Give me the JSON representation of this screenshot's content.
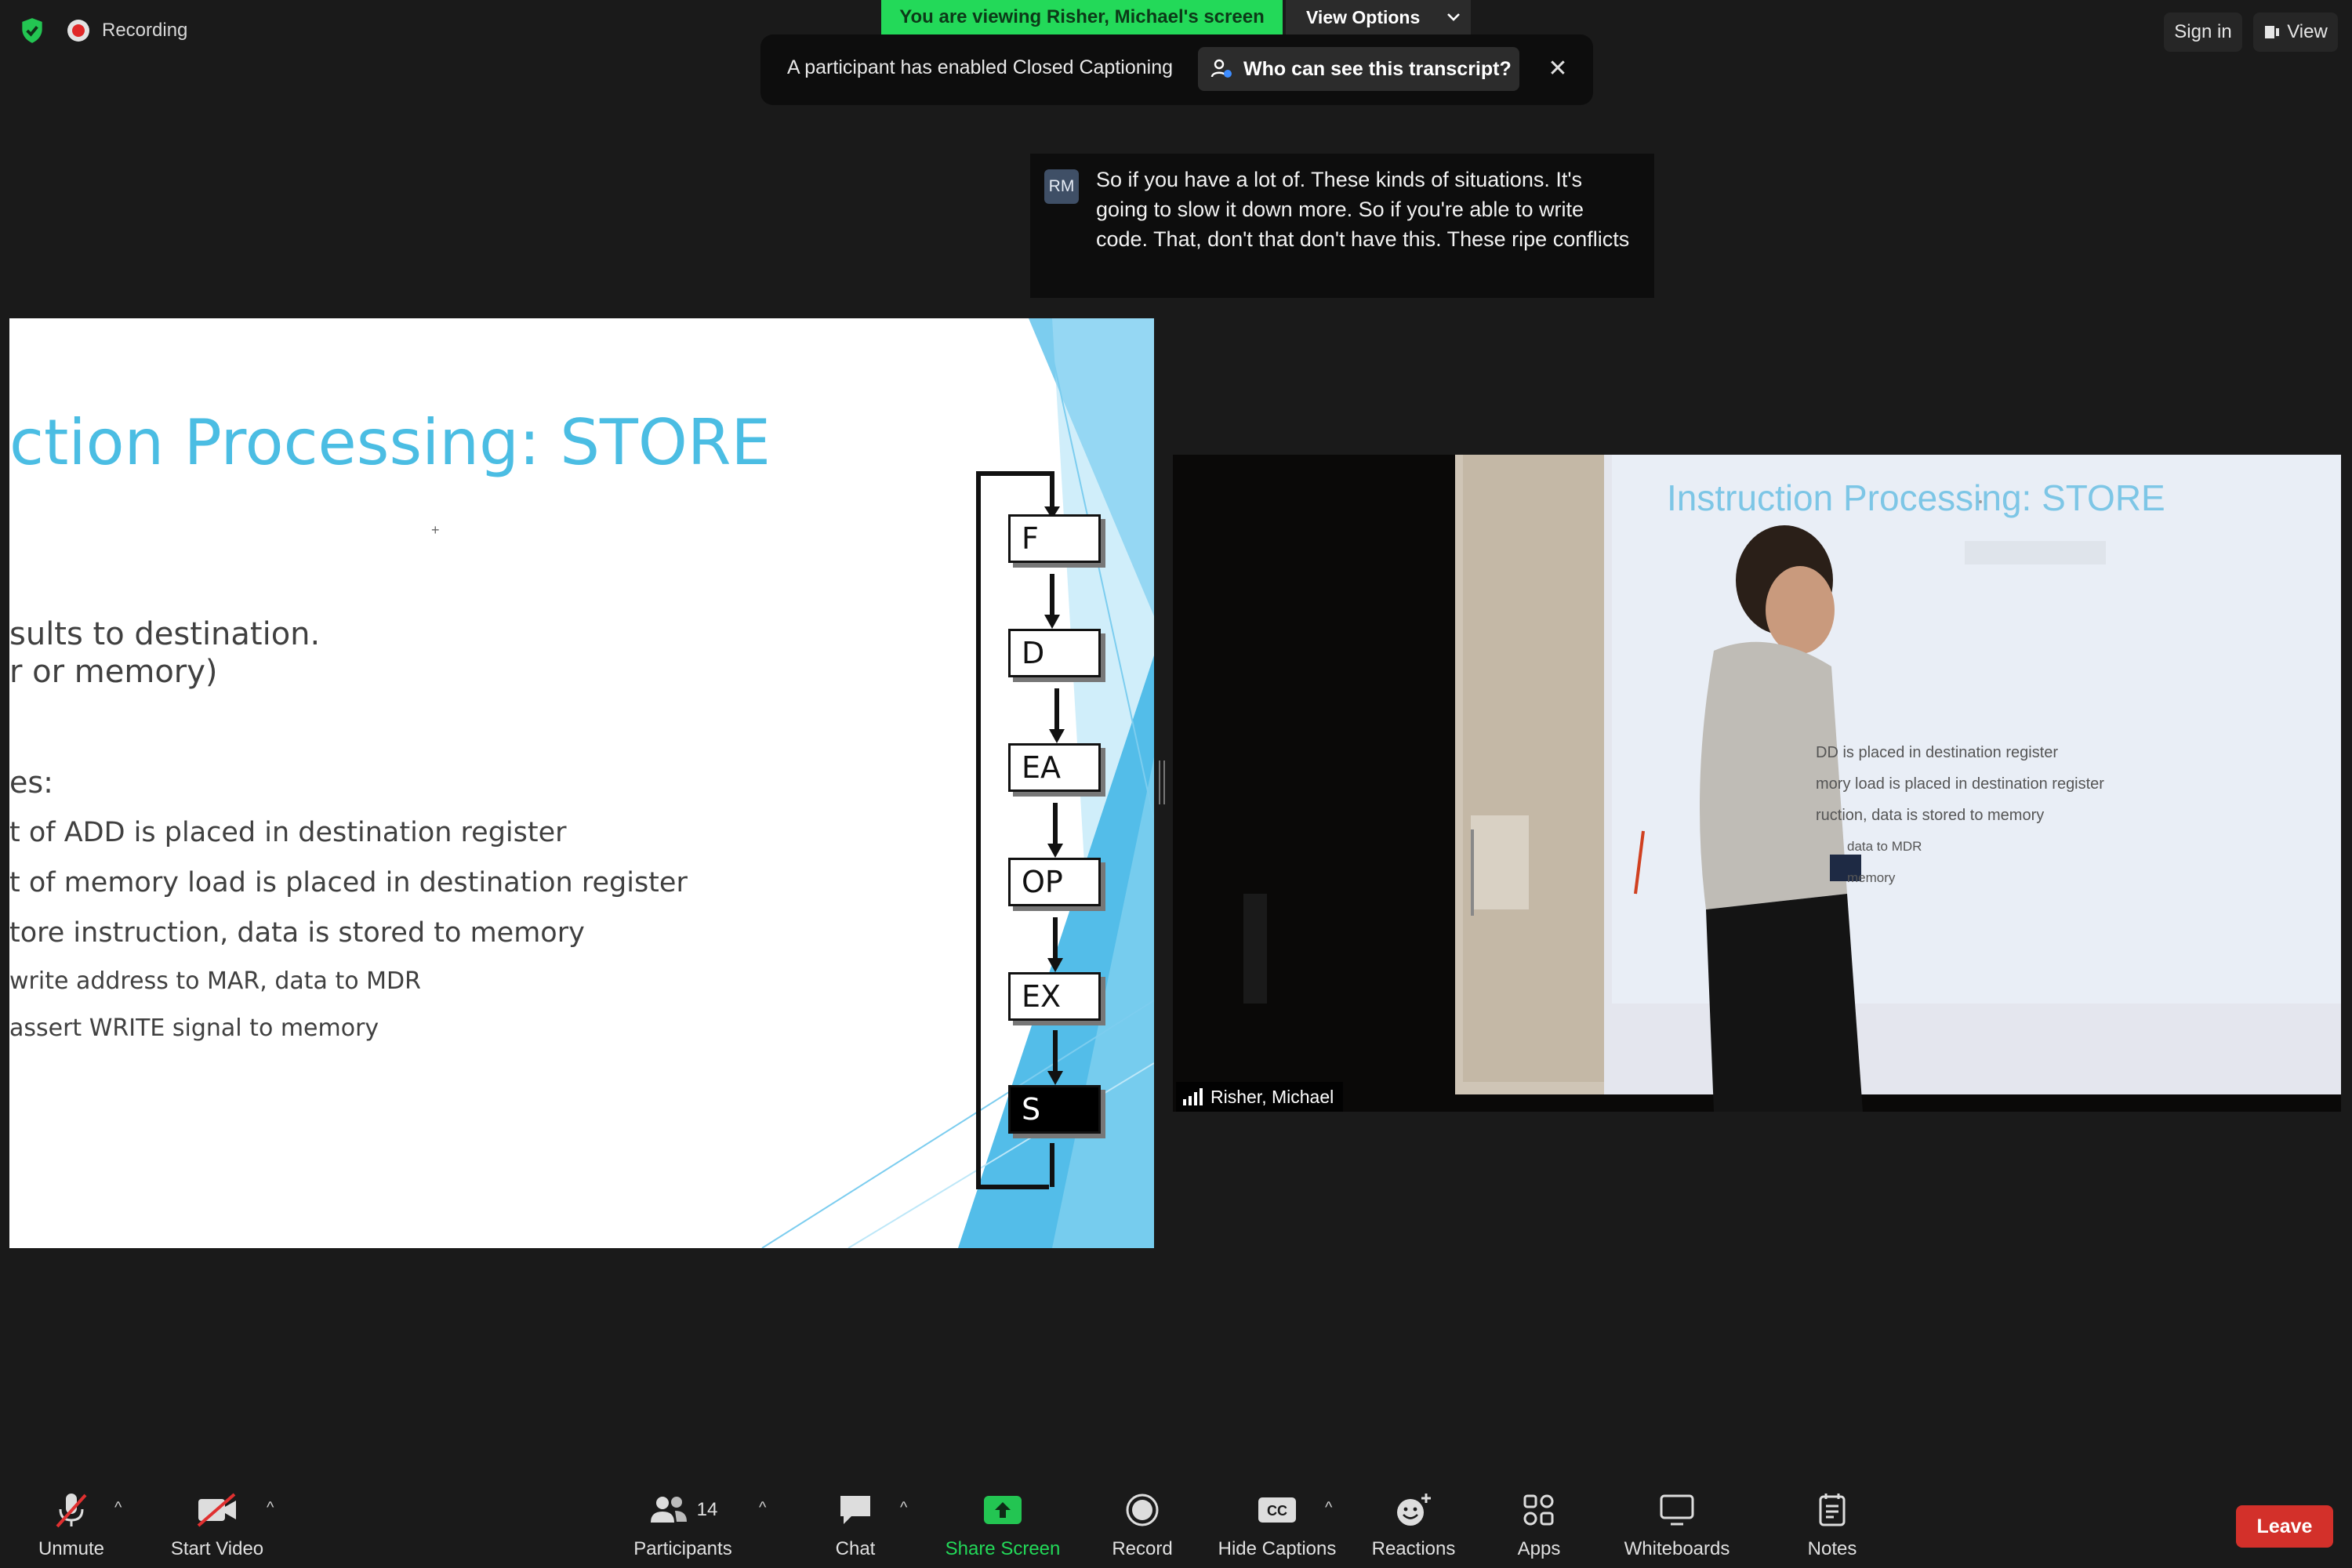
{
  "topbar": {
    "recording_label": "Recording",
    "viewing_banner": "You are viewing Risher, Michael's screen",
    "view_options": "View Options",
    "sign_in": "Sign in",
    "view": "View"
  },
  "cc_banner": {
    "message": "A participant has enabled Closed Captioning",
    "button": "Who can see this transcript?"
  },
  "transcript": {
    "initials": "RM",
    "text": "So if you have a lot of. These kinds of situations. It's going to slow it down more. So if you're able to write code. That, don't that don't have this. These ripe conflicts"
  },
  "slide": {
    "title": "ction Processing: STORE",
    "line1": "sults to destination.",
    "line2": "r or memory)",
    "line3": "es:",
    "line4": "t of ADD is placed in destination register",
    "line5": "t of memory load is placed in destination register",
    "line6": "tore instruction, data is stored to memory",
    "line7": "write address to MAR, data to MDR",
    "line8": "assert WRITE signal to memory",
    "stages": [
      "F",
      "D",
      "EA",
      "OP",
      "EX",
      "S"
    ]
  },
  "video": {
    "participant_name": "Risher, Michael",
    "projected_title": "Instruction Processing: STORE",
    "projected_lines": [
      "DD is placed in destination register",
      "mory load is placed in destination register",
      "ruction, data is stored to memory",
      "data to MDR",
      "memory"
    ]
  },
  "toolbar": {
    "unmute": "Unmute",
    "start_video": "Start Video",
    "participants": "Participants",
    "participants_count": "14",
    "chat": "Chat",
    "share_screen": "Share Screen",
    "record": "Record",
    "hide_captions": "Hide Captions",
    "reactions": "Reactions",
    "apps": "Apps",
    "whiteboards": "Whiteboards",
    "notes": "Notes",
    "leave": "Leave"
  },
  "colors": {
    "share_green": "#23d959",
    "leave_red": "#d3302a",
    "slide_title_blue": "#4bbde3"
  }
}
